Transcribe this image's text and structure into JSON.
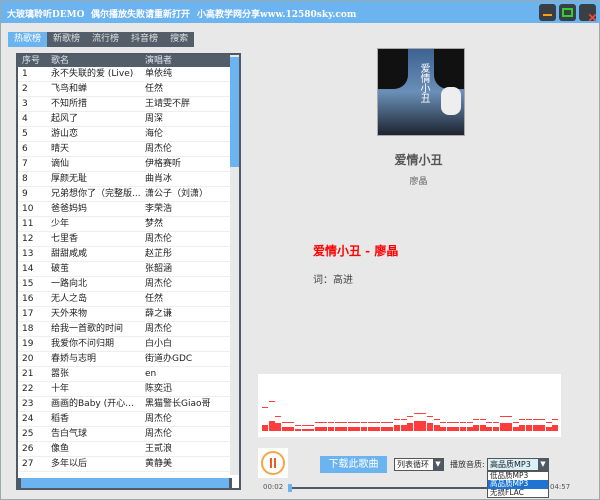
{
  "window": {
    "title": "大玻璃聆听DEMO",
    "notice": "偶尔播放失败请重新打开",
    "share": "小高教学网分享www.12580sky.com"
  },
  "tabs": [
    {
      "label": "热歌榜",
      "active": true
    },
    {
      "label": "新歌榜"
    },
    {
      "label": "流行榜"
    },
    {
      "label": "抖音榜"
    },
    {
      "label": "搜索"
    }
  ],
  "table": {
    "headers": [
      "序号",
      "歌名",
      "演唱者"
    ],
    "rows": [
      [
        "1",
        "永不失联的爱 (Live)",
        "单依纯"
      ],
      [
        "2",
        "飞鸟和蝉",
        "任然"
      ],
      [
        "3",
        "不知所措",
        "王靖雯不胖"
      ],
      [
        "4",
        "起风了",
        "周深"
      ],
      [
        "5",
        "游山恋",
        "海伦"
      ],
      [
        "6",
        "晴天",
        "周杰伦"
      ],
      [
        "7",
        "谪仙",
        "伊格赛听"
      ],
      [
        "8",
        "厚颜无耻",
        "曲肖冰"
      ],
      [
        "9",
        "兄弟想你了（完整版...",
        "潇公子（刘潇）"
      ],
      [
        "10",
        "爸爸妈妈",
        "李荣浩"
      ],
      [
        "11",
        "少年",
        "梦然"
      ],
      [
        "12",
        "七里香",
        "周杰伦"
      ],
      [
        "13",
        "甜甜咸咸",
        "赵芷彤"
      ],
      [
        "14",
        "破茧",
        "张韶涵"
      ],
      [
        "15",
        "一路向北",
        "周杰伦"
      ],
      [
        "16",
        "无人之岛",
        "任然"
      ],
      [
        "17",
        "天外来物",
        "薛之谦"
      ],
      [
        "18",
        "给我一首歌的时间",
        "周杰伦"
      ],
      [
        "19",
        "我爱你不问归期",
        "白小白"
      ],
      [
        "20",
        "春娇与志明",
        "街道办GDC"
      ],
      [
        "21",
        "嚣张",
        "en"
      ],
      [
        "22",
        "十年",
        "陈奕迅"
      ],
      [
        "23",
        "画画的Baby (开心真...",
        "黑猫警长Giao哥"
      ],
      [
        "24",
        "稻香",
        "周杰伦"
      ],
      [
        "25",
        "告白气球",
        "周杰伦"
      ],
      [
        "26",
        "像鱼",
        "王贰浪"
      ],
      [
        "27",
        "多年以后",
        "黄静美"
      ]
    ]
  },
  "now_playing": {
    "title": "爱情小丑",
    "artist": "廖晶",
    "art_text": "爱情小丑",
    "lyric_title": "爱情小丑 - 廖晶",
    "lyric_line": "词：高进"
  },
  "controls": {
    "download_label": "下载此歌曲",
    "loop_mode": "列表循环",
    "quality_label": "播放音质:",
    "quality_selected": "高品质MP3",
    "quality_options": [
      "低品质MP3",
      "高品质MP3",
      "无损FLAC"
    ],
    "quality_highlighted": "高品质MP3",
    "time_current": "00:02",
    "time_total": "04:57",
    "progress_percent": 1
  },
  "colors": {
    "accent": "#6cb4f0",
    "header": "#535e6b",
    "lyric": "#ff0000",
    "spectrum": "#ff3b3b"
  }
}
